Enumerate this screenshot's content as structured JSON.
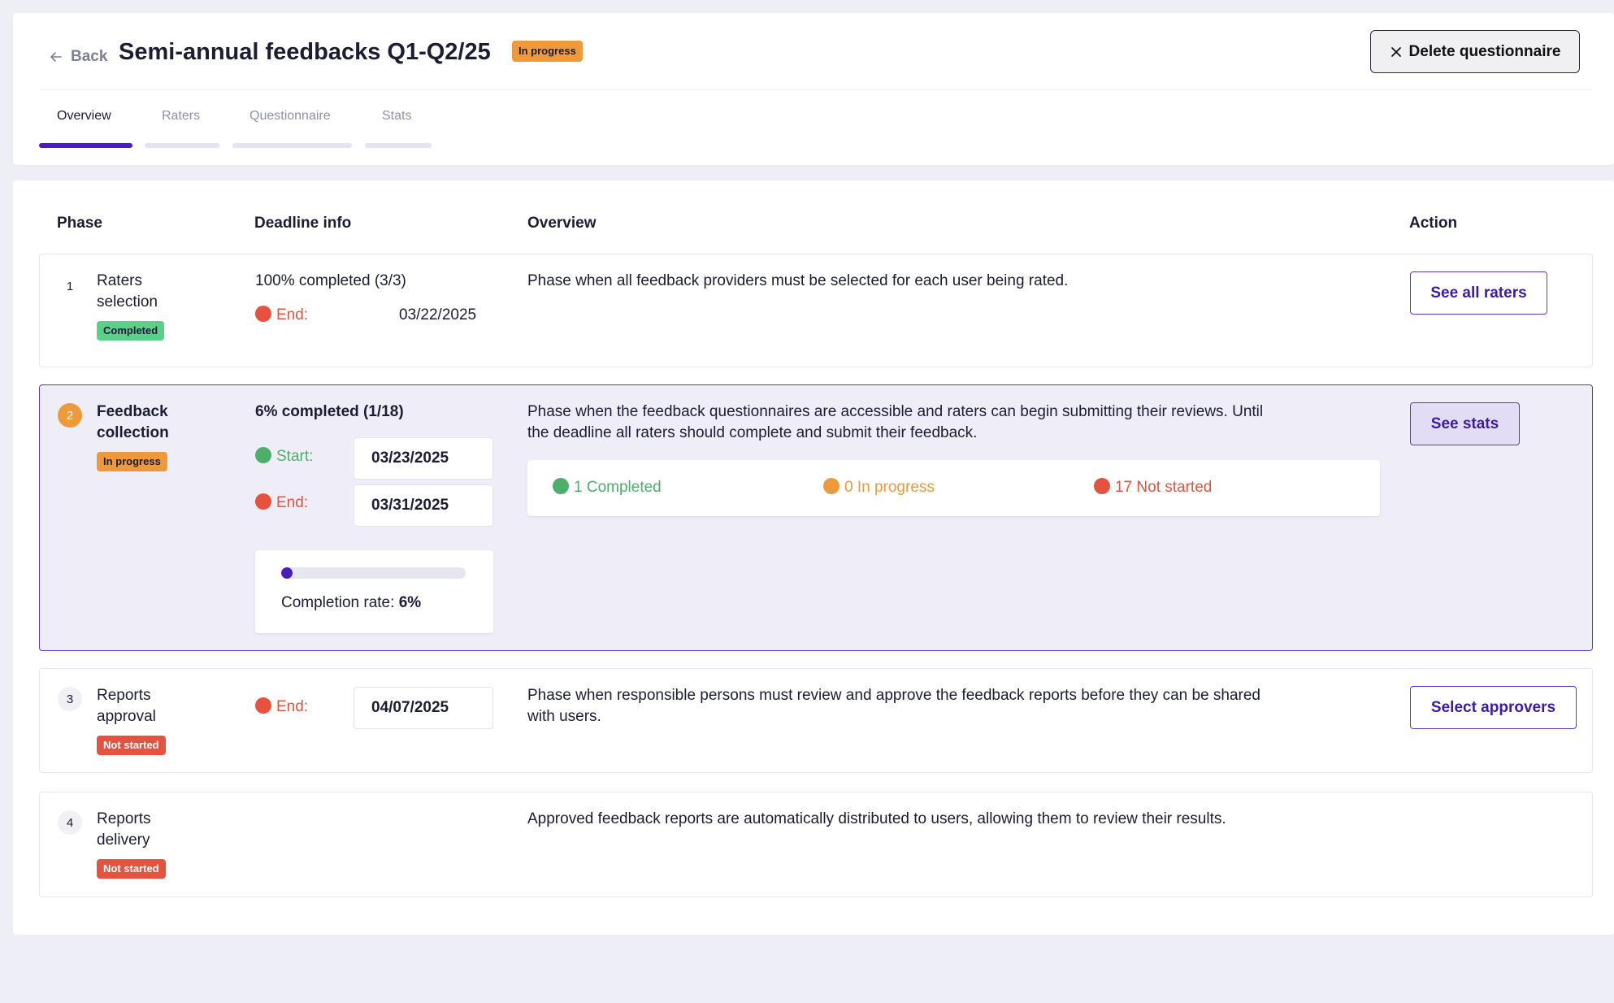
{
  "header": {
    "back_label": "Back",
    "title": "Semi-annual feedbacks Q1-Q2/25",
    "status_badge": "In progress",
    "delete_label": "Delete questionnaire"
  },
  "tabs": [
    {
      "label": "Overview",
      "active": true
    },
    {
      "label": "Raters",
      "active": false
    },
    {
      "label": "Questionnaire",
      "active": false
    },
    {
      "label": "Stats",
      "active": false
    }
  ],
  "columns": {
    "phase": "Phase",
    "deadline": "Deadline info",
    "overview": "Overview",
    "action": "Action"
  },
  "phases": [
    {
      "number": "1",
      "name_line1": "Raters",
      "name_line2": "selection",
      "status": "Completed",
      "completion": "100% completed (3/3)",
      "end_label": "End:",
      "end_date": "03/22/2025",
      "overview": "Phase when all feedback providers must be selected for each user being rated.",
      "action_label": "See all raters"
    },
    {
      "number": "2",
      "name_line1": "Feedback",
      "name_line2": "collection",
      "status": "In progress",
      "completion": "6% completed (1/18)",
      "start_label": "Start:",
      "start_date": "03/23/2025",
      "end_label": "End:",
      "end_date": "03/31/2025",
      "overview_line1": "Phase when the feedback questionnaires are accessible and raters can begin submitting their reviews. Until",
      "overview_line2": "the deadline all raters should complete and submit their feedback.",
      "stats": {
        "completed": "1 Completed",
        "in_progress": "0 In progress",
        "not_started": "17 Not started"
      },
      "completion_rate_label": "Completion rate:",
      "completion_rate_value": "6%",
      "completion_rate_fraction": 0.06,
      "action_label": "See stats"
    },
    {
      "number": "3",
      "name_line1": "Reports",
      "name_line2": "approval",
      "status": "Not started",
      "end_label": "End:",
      "end_date": "04/07/2025",
      "overview_line1": "Phase when responsible persons must review and approve the feedback reports before they can be shared",
      "overview_line2": "with users.",
      "action_label": "Select approvers"
    },
    {
      "number": "4",
      "name_line1": "Reports",
      "name_line2": "delivery",
      "status": "Not started",
      "overview": "Approved feedback reports are automatically distributed  to users, allowing them to review their results."
    }
  ],
  "colors": {
    "accent": "#4a1fb8",
    "in_progress": "#ef9a3a",
    "completed": "#5bd08a",
    "not_started": "#e5533f"
  }
}
